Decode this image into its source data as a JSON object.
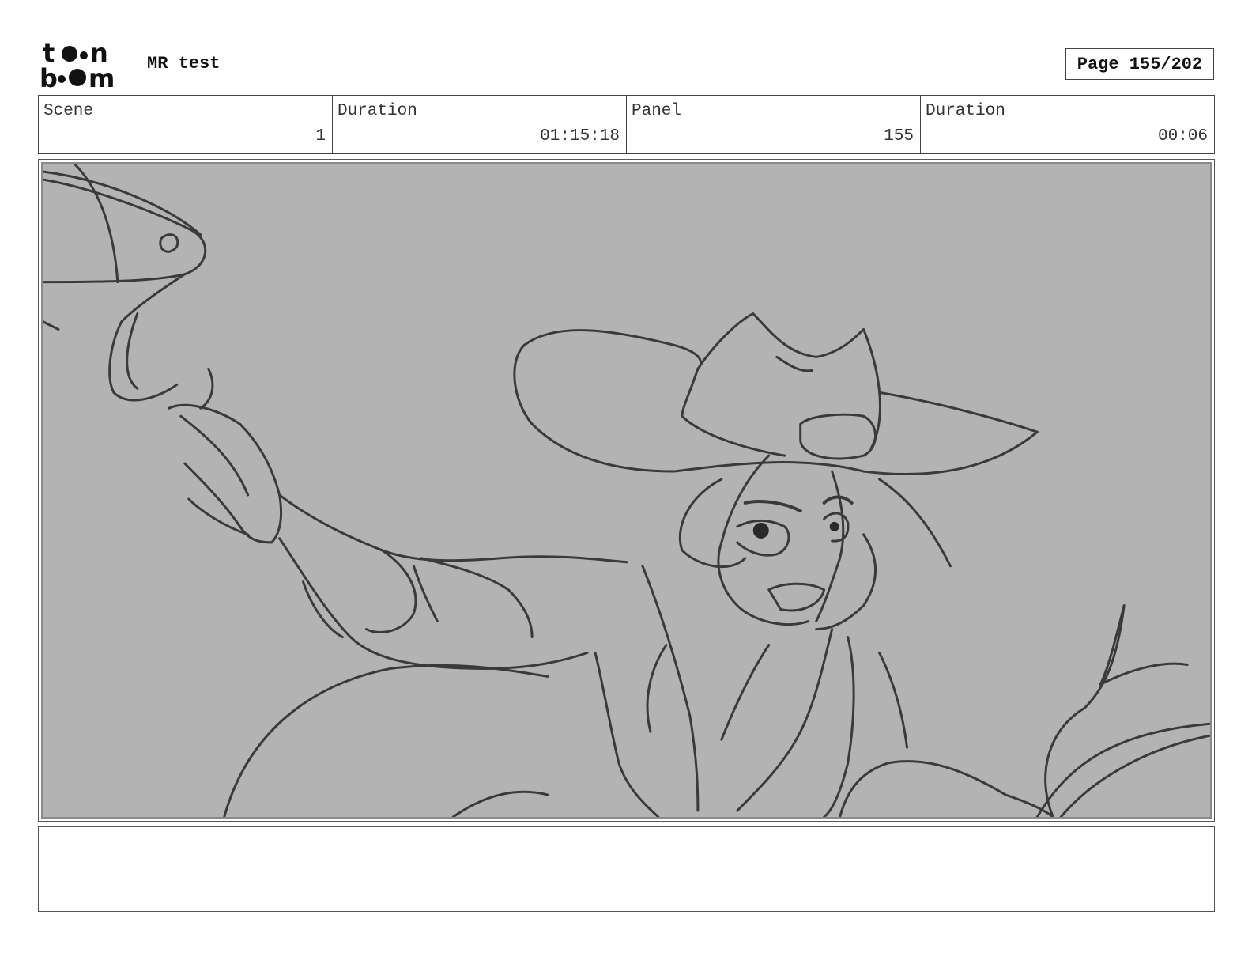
{
  "header": {
    "logo_text": "toon boom",
    "project_title": "MR test",
    "page_indicator": "Page 155/202"
  },
  "info": {
    "scene_label": "Scene",
    "scene_value": "1",
    "scene_duration_label": "Duration",
    "scene_duration_value": "01:15:18",
    "panel_label": "Panel",
    "panel_value": "155",
    "panel_duration_label": "Duration",
    "panel_duration_value": "00:06"
  },
  "panel": {
    "background_color": "#b3b3b3",
    "line_color": "#3a3a3a",
    "icon": "storyboard-sketch-cowgirl-hat"
  },
  "notes": {
    "text": ""
  }
}
